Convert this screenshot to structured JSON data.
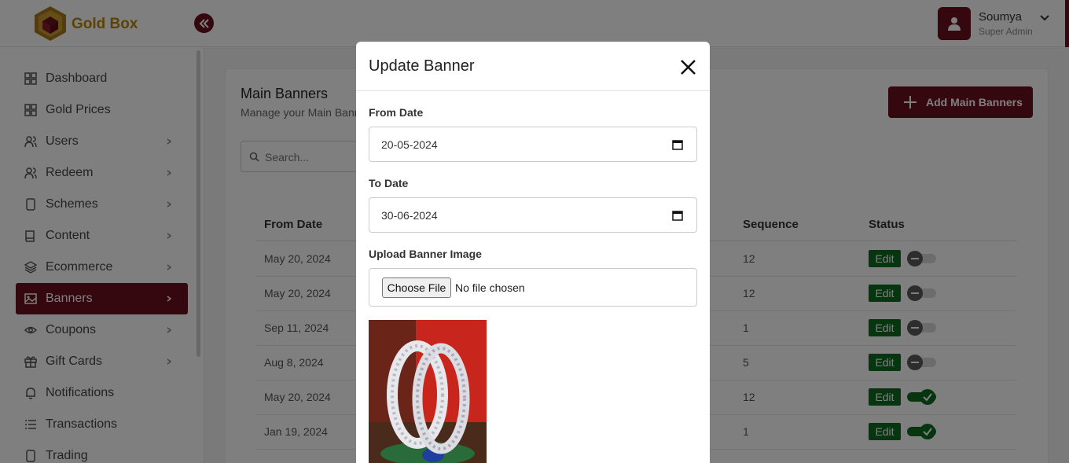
{
  "app": {
    "brand": "Gold Box"
  },
  "user": {
    "name": "Soumya",
    "role": "Super Admin"
  },
  "sidebar": {
    "items": [
      {
        "label": "Dashboard",
        "icon": "grid-icon",
        "has_children": false
      },
      {
        "label": "Gold Prices",
        "icon": "grid-icon",
        "has_children": false
      },
      {
        "label": "Users",
        "icon": "users-icon",
        "has_children": true
      },
      {
        "label": "Redeem",
        "icon": "users-icon",
        "has_children": true
      },
      {
        "label": "Schemes",
        "icon": "mobile-icon",
        "has_children": true
      },
      {
        "label": "Content",
        "icon": "book-icon",
        "has_children": true
      },
      {
        "label": "Ecommerce",
        "icon": "layers-icon",
        "has_children": true
      },
      {
        "label": "Banners",
        "icon": "image-icon",
        "has_children": true,
        "active": true
      },
      {
        "label": "Coupons",
        "icon": "eye-icon",
        "has_children": true
      },
      {
        "label": "Gift Cards",
        "icon": "gift-icon",
        "has_children": true
      },
      {
        "label": "Notifications",
        "icon": "bell-icon",
        "has_children": false
      },
      {
        "label": "Transactions",
        "icon": "list-icon",
        "has_children": false
      },
      {
        "label": "Trading",
        "icon": "mobile-icon",
        "has_children": false
      }
    ]
  },
  "page": {
    "title": "Main Banners",
    "subtitle": "Manage your Main Banners",
    "add_button": "Add Main Banners",
    "search_placeholder": "Search..."
  },
  "table": {
    "columns": {
      "from_date": "From Date",
      "sequence": "Sequence",
      "status": "Status"
    },
    "edit_label": "Edit",
    "rows": [
      {
        "from_date": "May 20, 2024",
        "sequence": "12",
        "active": false
      },
      {
        "from_date": "May 20, 2024",
        "sequence": "12",
        "active": false
      },
      {
        "from_date": "Sep 11, 2024",
        "sequence": "1",
        "active": false
      },
      {
        "from_date": "Aug 8, 2024",
        "sequence": "5",
        "active": false
      },
      {
        "from_date": "May 20, 2024",
        "sequence": "12",
        "active": true
      },
      {
        "from_date": "Jan 19, 2024",
        "sequence": "1",
        "active": true
      }
    ]
  },
  "modal": {
    "title": "Update Banner",
    "from_label": "From Date",
    "from_value": "20-05-2024",
    "to_label": "To Date",
    "to_value": "30-06-2024",
    "upload_label": "Upload Banner Image",
    "choose_file": "Choose File",
    "no_file": "No file chosen"
  },
  "colors": {
    "brand": "#6b0e1e",
    "gold": "#b8860b",
    "edit": "#0f6b1e"
  }
}
